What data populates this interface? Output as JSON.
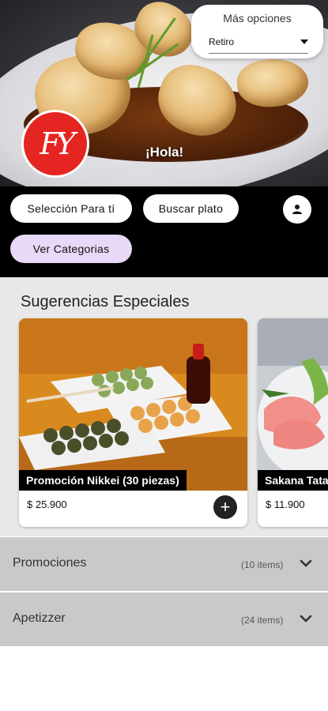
{
  "hero": {
    "greeting": "¡Hola!",
    "logo_text": "FY"
  },
  "options": {
    "title": "Más opciones",
    "selected": "Retiro"
  },
  "nav": {
    "selection_label": "Selección Para tí",
    "search_label": "Buscar plato",
    "categories_label": "Ver Categorias"
  },
  "suggestions": {
    "title": "Sugerencias Especiales",
    "items": [
      {
        "name": "Promoción Nikkei (30 piezas)",
        "price": "$ 25.900"
      },
      {
        "name": "Sakana Tataki",
        "price": "$ 11.900"
      }
    ]
  },
  "categories": [
    {
      "name": "Promociones",
      "count": "(10 items)"
    },
    {
      "name": "Apetizzer",
      "count": "(24 items)"
    }
  ],
  "colors": {
    "brand_red": "#e52521",
    "active_pill": "#e7d9f7",
    "category_bg": "#c9c9c9"
  }
}
